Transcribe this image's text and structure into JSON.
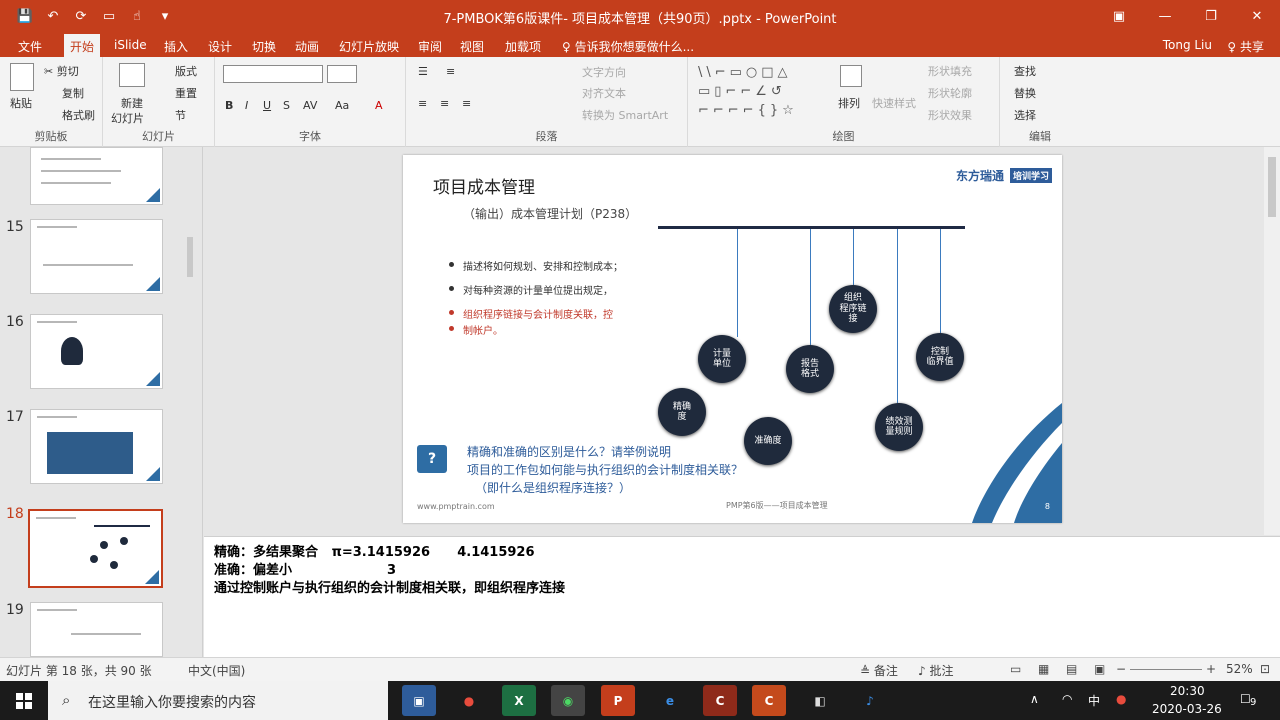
{
  "window": {
    "title": "7-PMBOK第6版课件- 项目成本管理（共90页）.pptx - PowerPoint",
    "controls": [
      "—",
      "❐",
      "✕"
    ]
  },
  "tabs": [
    "文件",
    "开始",
    "iSlide",
    "插入",
    "设计",
    "切换",
    "动画",
    "幻灯片放映",
    "审阅",
    "视图",
    "加载项"
  ],
  "tell_me": "♀ 告诉我你想要做什么...",
  "user": "Tong Liu",
  "share": "♀ 共享",
  "ribbon": {
    "clipboard": {
      "paste": "粘贴",
      "cut": "✂ 剪切",
      "copy": "复制",
      "format_painter": "格式刷",
      "label": "剪贴板"
    },
    "slides": {
      "new_slide": "新建",
      "new_slide2": "幻灯片",
      "layout": "版式",
      "reset": "重置",
      "section": "节",
      "label": "幻灯片"
    },
    "font": {
      "label": "字体"
    },
    "paragraph": {
      "text_direction": "文字方向",
      "align_text": "对齐文本",
      "smartart": "转换为 SmartArt",
      "label": "段落"
    },
    "drawing": {
      "arrange": "排列",
      "quick_styles": "快速样式",
      "shape_fill": "形状填充",
      "shape_outline": "形状轮廓",
      "shape_effects": "形状效果",
      "label": "绘图"
    },
    "editing": {
      "find": "查找",
      "replace": "替换",
      "select": "选择",
      "label": "编辑"
    }
  },
  "thumbnails": [
    {
      "num": "",
      "selected": false
    },
    {
      "num": "15",
      "selected": false
    },
    {
      "num": "16",
      "selected": false
    },
    {
      "num": "17",
      "selected": false
    },
    {
      "num": "18",
      "selected": true
    },
    {
      "num": "19",
      "selected": false
    }
  ],
  "slide": {
    "title": "项目成本管理",
    "subtitle": "（输出）成本管理计划（P238）",
    "logo": "东方瑞通",
    "logo_badge": "培训学习",
    "bullets": [
      "描述将如何规划、安排和控制成本；",
      "对每种资源的计量单位提出规定，",
      "组织程序链接与会计制度关联，控",
      "制帐户。"
    ],
    "nodes": [
      "计量\n单位",
      "报告\n格式",
      "组织\n程序链\n接",
      "控制\n临界值",
      "精确\n度",
      "准确度",
      "绩效测\n量规则"
    ],
    "question_line1": "精确和准确的区别是什么？请举例说明",
    "question_line2": "项目的工作包如何能与执行组织的会计制度相关联？",
    "question_line3": "（即什么是组织程序连接？）",
    "footer_left": "www.pmptrain.com",
    "footer_mid": "PMP第6版——项目成本管理",
    "page": "8"
  },
  "notes": {
    "line1": "精确：多结果聚合   π=3.1415926      4.1415926",
    "line2": "准确：偏差小                     3",
    "line3": "通过控制账户与执行组织的会计制度相关联，即组织程序连接"
  },
  "status": {
    "slide_info": "幻灯片 第 18 张，共 90 张",
    "language": "中文(中国)",
    "notes": "≜ 备注",
    "comments": "♪ 批注",
    "zoom": "52%"
  },
  "taskbar": {
    "search_placeholder": "在这里输入你要搜索的内容",
    "apps": [
      "▣",
      "●",
      "X",
      "◉",
      "P",
      "e",
      "C",
      "C",
      "◧",
      "♪"
    ],
    "time": "20:30",
    "date": "2020-03-26",
    "ime": "中",
    "notif": "9"
  }
}
